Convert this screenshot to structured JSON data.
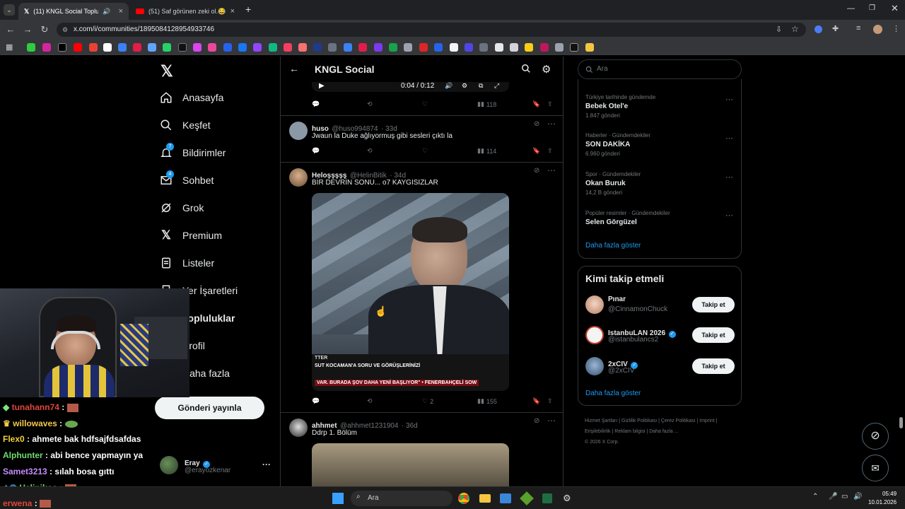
{
  "browser": {
    "tabs": [
      {
        "label": "(11) KNGL Social Topluluk /",
        "active": true
      },
      {
        "label": "(51) Saf görünen zeki ol.😂 - Yo",
        "active": false
      }
    ],
    "new_tab": "+",
    "url": "x.com/i/communities/1895084128954933746"
  },
  "nav": {
    "items": [
      {
        "label": "Anasayfa",
        "icon": "home-icon"
      },
      {
        "label": "Keşfet",
        "icon": "search-icon"
      },
      {
        "label": "Bildirimler",
        "icon": "bell-icon",
        "badge": "7"
      },
      {
        "label": "Sohbet",
        "icon": "mail-icon",
        "badge": "4"
      },
      {
        "label": "Grok",
        "icon": "grok-icon"
      },
      {
        "label": "Premium",
        "icon": "x-logo-icon"
      },
      {
        "label": "Listeler",
        "icon": "list-icon"
      },
      {
        "label": "Yer İşaretleri",
        "icon": "bookmark-icon"
      },
      {
        "label": "Topluluklar",
        "icon": "communities-icon"
      },
      {
        "label": "Profil",
        "icon": "profile-icon"
      },
      {
        "label": "Daha fazla",
        "icon": "more-icon"
      }
    ],
    "post_button": "Gönderi yayınla",
    "account": {
      "name": "Eray",
      "handle": "@erayozkenar",
      "more": "···"
    }
  },
  "center": {
    "title": "KNGL Social",
    "video_time": "0:04 / 0:12",
    "post0": {
      "views": "118"
    },
    "post1": {
      "name": "huso",
      "handle": "@huso994874",
      "time": "· 33d",
      "text": "Jwaun la Duke ağlıyormuş gibi sesleri çıktı la",
      "views": "114"
    },
    "post2": {
      "name": "Heloşşşşş",
      "handle": "@HelinBitik",
      "time": "· 34d",
      "text": "BİR DEVRİN SONU... o7 KAYGISIZLAR",
      "likes": "2",
      "views": "155",
      "caption1": "SUT KOCAMAN'A SORU VE GÖRÜŞLERİNİZİ",
      "caption2": "VAR. BURADA ŞOV DAHA YENİ BAŞLIYOR\"  •  FENERBAHÇELİ SOW",
      "caption_tag": "TTER"
    },
    "post3": {
      "name": "ahhmet",
      "handle": "@ahhmet1231904",
      "time": "· 36d",
      "text": "Ddrp 1. Bölüm"
    }
  },
  "right": {
    "search_placeholder": "Ara",
    "trends": [
      {
        "category": "Türkiye tarihinde gündemde",
        "title": "Bebek Otel'e",
        "count": "1.847 gönderi"
      },
      {
        "category": "Haberler · Gündemdekiler",
        "title": "SON DAKİKA",
        "count": "6.960 gönderi"
      },
      {
        "category": "Spor · Gündemdekiler",
        "title": "Okan Buruk",
        "count": "14,2 B gönderi"
      },
      {
        "category": "Popüler resimler · Gündemdekiler",
        "title": "Selen Görgüzel",
        "count": ""
      }
    ],
    "trends_more": "Daha fazla göster",
    "who_title": "Kimi takip etmeli",
    "who": [
      {
        "name": "Pınar",
        "handle": "@CinnamonChuck",
        "verified": false
      },
      {
        "name": "IstanbuLAN 2026",
        "handle": "@istanbulancs2",
        "verified": true
      },
      {
        "name": "2xCIV",
        "handle": "@2xCIV",
        "verified": true
      }
    ],
    "follow_label": "Takip et",
    "who_more": "Daha fazla göster",
    "footer": [
      "Hizmet Şartları",
      "Gizlilik Politikası",
      "Çerez Politikası",
      "Imprint",
      "Erişilebilirlik",
      "Reklam bilgisi",
      "Daha fazla ...",
      "© 2026 X Corp."
    ]
  },
  "chat": [
    {
      "user": "tunahann74",
      "msg": "",
      "color": "#e0453b"
    },
    {
      "user": "willowaves",
      "msg": "",
      "color": "#f2c94c"
    },
    {
      "user": "Flex0",
      "msg": "ahmete bak hdfsajfdsafdas",
      "color": "#f2d33b"
    },
    {
      "user": "Alphunter",
      "msg": "abi bence yapmayın ya",
      "color": "#6fdc6f"
    },
    {
      "user": "Samet3213",
      "msg": "sılah bosa gıttı",
      "color": "#c78bff"
    },
    {
      "user": "Helinikoo",
      "msg": "",
      "color": "#6fdc6f"
    },
    {
      "user": "erwena",
      "msg": "",
      "color": "#e0453b"
    }
  ],
  "taskbar": {
    "search": "Ara",
    "time": "05:49",
    "date": "10.01.2026"
  },
  "colors": {
    "accent": "#1d9bf0",
    "bg": "#000000",
    "border": "#2f3336"
  }
}
